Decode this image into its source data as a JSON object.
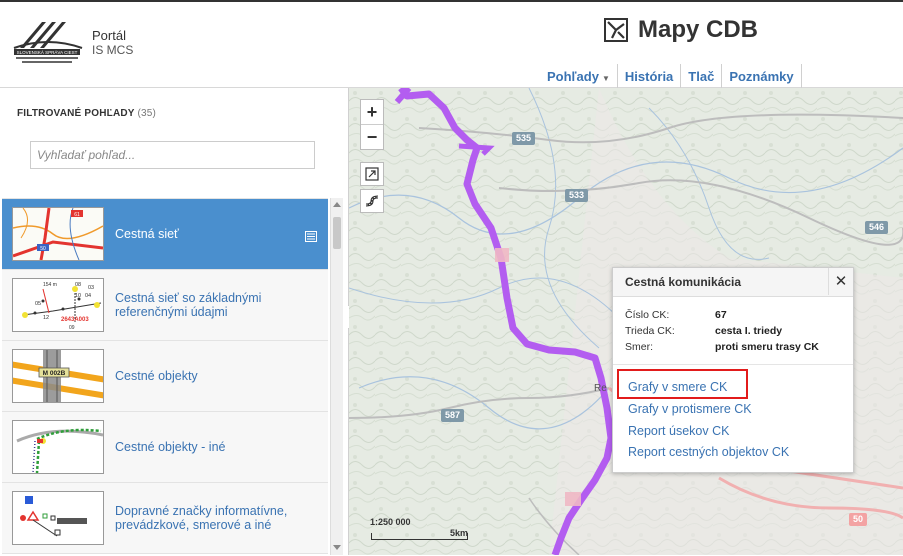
{
  "header": {
    "logo_text": "SLOVENSKÁ SPRÁVA CIEST",
    "portal_name": "Portál",
    "portal_sub": "IS MCS",
    "app_title": "Mapy CDB",
    "nav": [
      {
        "label": "Pohľady",
        "has_caret": true
      },
      {
        "label": "História"
      },
      {
        "label": "Tlač"
      },
      {
        "label": "Poznámky"
      }
    ]
  },
  "sidebar": {
    "heading": "FILTROVANÉ POHĽADY",
    "count": "(35)",
    "search_placeholder": "Vyhľadať pohľad...",
    "collapse_glyph": "‹",
    "items": [
      {
        "label": "Cestná sieť",
        "active": true
      },
      {
        "label": "Cestná sieť so základnými referenčnými údajmi"
      },
      {
        "label": "Cestné objekty"
      },
      {
        "label": "Cestné objekty - iné"
      },
      {
        "label": "Dopravné značky informatívne, prevádzkové, smerové a iné"
      }
    ],
    "thumb_labels": {
      "road61": "61",
      "road50": "50",
      "station": "154 m",
      "n05": "05",
      "n12": "12",
      "n08": "08",
      "n03": "03",
      "n10": "10",
      "n04": "04",
      "n09": "09",
      "code": "2643A003",
      "bridge": "M 002B"
    }
  },
  "map": {
    "zoom_in": "+",
    "zoom_out": "−",
    "road_numbers": [
      "535",
      "533",
      "546",
      "587",
      "50"
    ],
    "place_fragment": "Re",
    "scale_label": "1:250 000",
    "scale_km": "5km"
  },
  "popup": {
    "title": "Cestná komunikácia",
    "close": "✕",
    "attributes": [
      {
        "key": "Číslo CK:",
        "value": "67"
      },
      {
        "key": "Trieda CK:",
        "value": "cesta I. triedy"
      },
      {
        "key": "Smer:",
        "value": "proti smeru trasy CK"
      }
    ],
    "links": [
      "Grafy v smere CK",
      "Grafy v protismere CK",
      "Report úsekov CK",
      "Report cestných objektov CK"
    ]
  },
  "colors": {
    "accent_blue": "#3a73b2",
    "active_item": "#4a8fce",
    "route_purple": "#b35df0",
    "highlight_red": "#e21b1b"
  }
}
